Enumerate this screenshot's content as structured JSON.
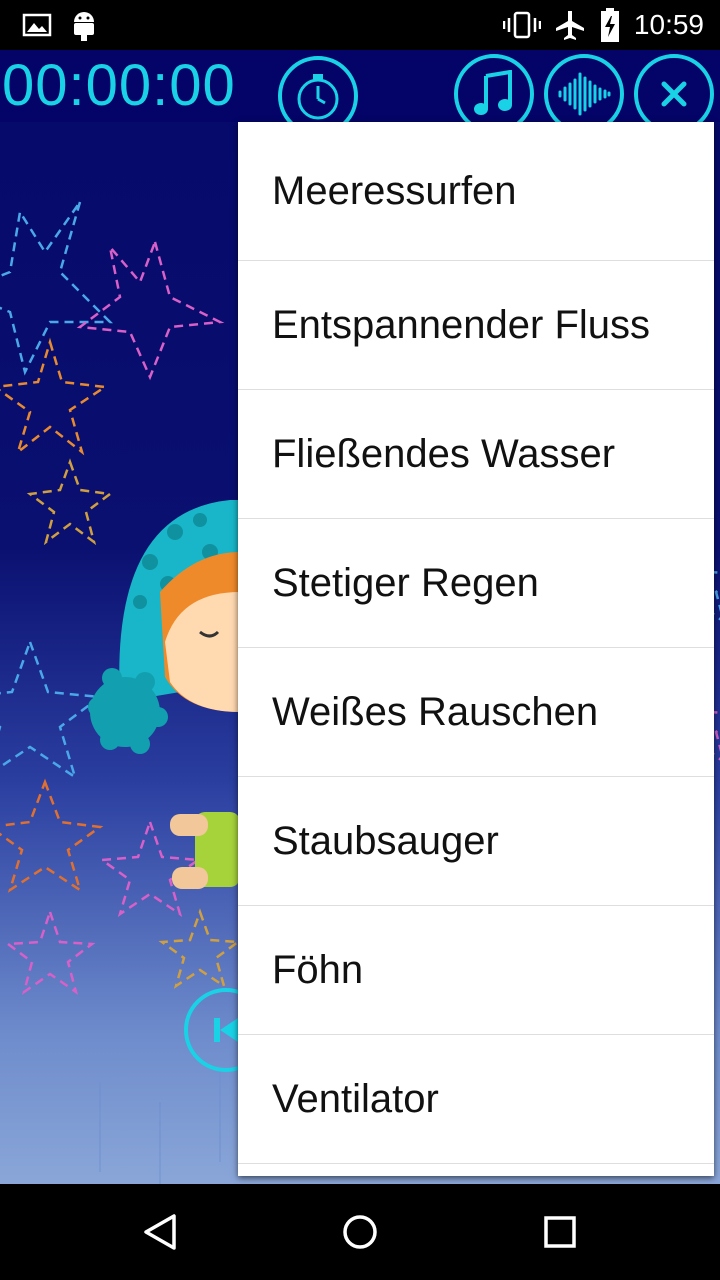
{
  "status_bar": {
    "time": "10:59",
    "icons": [
      "gallery-icon",
      "android-icon",
      "vibrate-icon",
      "airplane-icon",
      "battery-charging-icon"
    ]
  },
  "app_bar": {
    "timer": "00:00:00",
    "accent_color": "#19d2e6",
    "background_color": "#040468",
    "buttons": [
      "stopwatch-icon",
      "music-note-icon",
      "sound-wave-icon",
      "close-icon"
    ]
  },
  "player": {
    "previous_icon": "skip-previous-icon"
  },
  "menu": {
    "items": [
      {
        "label": "Meeressurfen"
      },
      {
        "label": "Entspannender Fluss"
      },
      {
        "label": "Fließendes Wasser"
      },
      {
        "label": "Stetiger Regen"
      },
      {
        "label": "Weißes Rauschen"
      },
      {
        "label": "Staubsauger"
      },
      {
        "label": "Föhn"
      },
      {
        "label": "Ventilator"
      }
    ]
  },
  "nav_bar": {
    "icons": [
      "back-icon",
      "home-icon",
      "recents-icon"
    ]
  }
}
